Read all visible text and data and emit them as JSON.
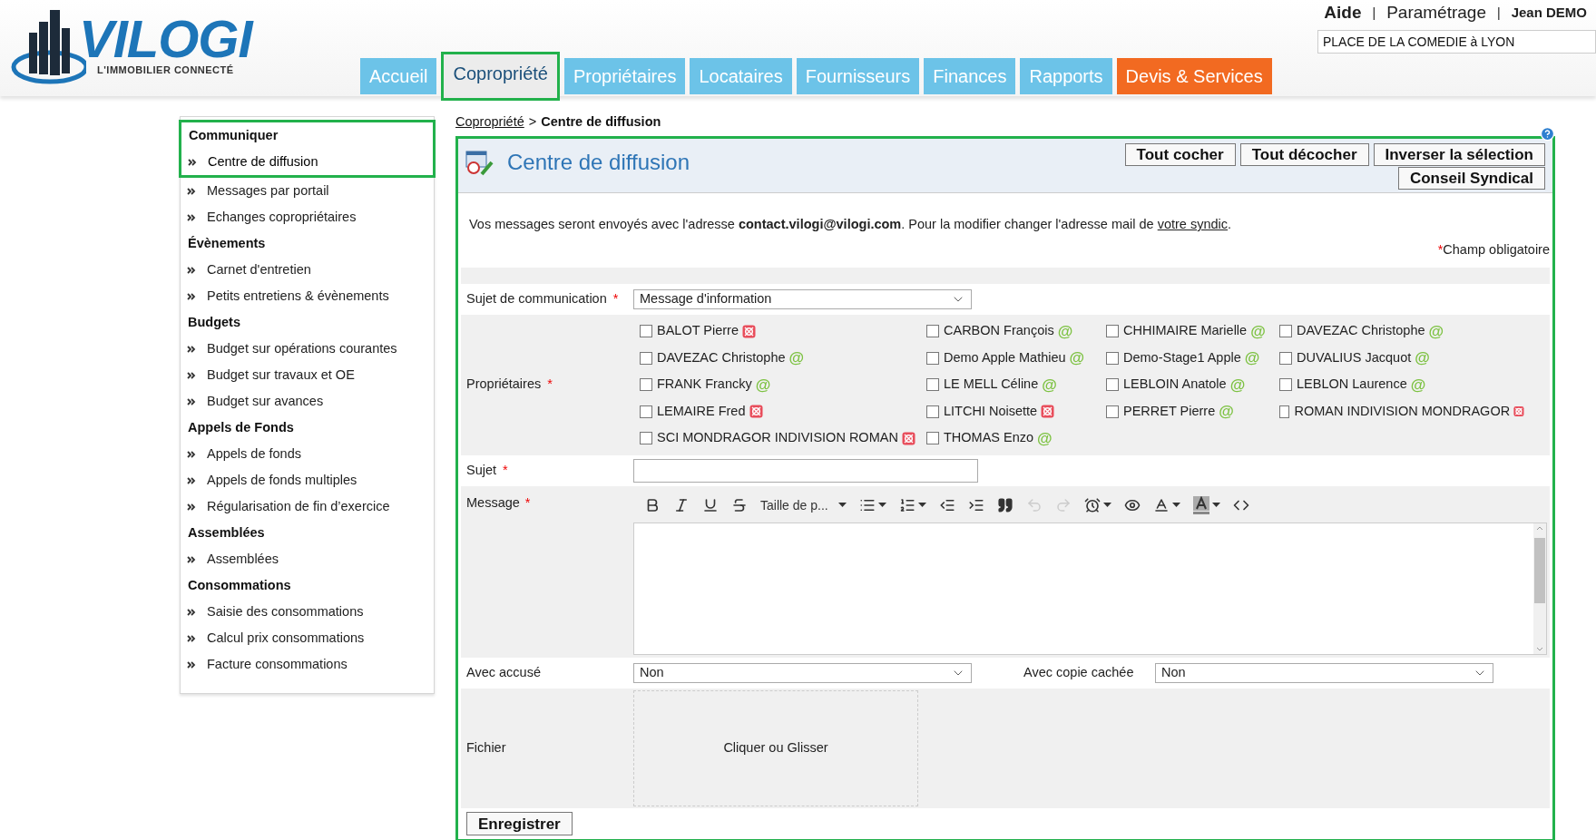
{
  "logo": {
    "name": "VILOGI",
    "tagline": "L'IMMOBILIER CONNECTÉ"
  },
  "top_separator": "|",
  "top_links": [
    {
      "label": "Aide",
      "kind": "link"
    },
    {
      "label": "Paramétrage",
      "kind": "link"
    },
    {
      "label": "Jean DEMO",
      "kind": "user"
    }
  ],
  "address_field": {
    "value": "PLACE DE LA COMEDIE à LYON"
  },
  "tabs": [
    {
      "label": "Accueil",
      "selected": false,
      "kind": "normal"
    },
    {
      "label": "Copropriété",
      "selected": true,
      "kind": "normal"
    },
    {
      "label": "Propriétaires",
      "selected": false,
      "kind": "normal"
    },
    {
      "label": "Locataires",
      "selected": false,
      "kind": "normal"
    },
    {
      "label": "Fournisseurs",
      "selected": false,
      "kind": "normal"
    },
    {
      "label": "Finances",
      "selected": false,
      "kind": "normal"
    },
    {
      "label": "Rapports",
      "selected": false,
      "kind": "normal"
    },
    {
      "label": "Devis & Services",
      "selected": false,
      "kind": "accent"
    }
  ],
  "sidebar": {
    "groups": [
      {
        "title": "Communiquer",
        "items": [
          {
            "label": "Centre de diffusion",
            "selected": true
          },
          {
            "label": "Messages par portail",
            "selected": false
          },
          {
            "label": "Echanges copropriétaires",
            "selected": false
          }
        ]
      },
      {
        "title": "Évènements",
        "items": [
          {
            "label": "Carnet d'entretien",
            "selected": false
          },
          {
            "label": "Petits entretiens & évènements",
            "selected": false
          }
        ]
      },
      {
        "title": "Budgets",
        "items": [
          {
            "label": "Budget sur opérations courantes",
            "selected": false
          },
          {
            "label": "Budget sur travaux et OE",
            "selected": false
          },
          {
            "label": "Budget sur avances",
            "selected": false
          }
        ]
      },
      {
        "title": "Appels de Fonds",
        "items": [
          {
            "label": "Appels de fonds",
            "selected": false
          },
          {
            "label": "Appels de fonds multiples",
            "selected": false
          },
          {
            "label": "Régularisation de fin d’exercice",
            "selected": false
          }
        ]
      },
      {
        "title": "Assemblées",
        "items": [
          {
            "label": "Assemblées",
            "selected": false
          }
        ]
      },
      {
        "title": "Consommations",
        "items": [
          {
            "label": "Saisie des consommations",
            "selected": false
          },
          {
            "label": "Calcul prix consommations",
            "selected": false
          },
          {
            "label": "Facture consommations",
            "selected": false
          }
        ]
      }
    ]
  },
  "breadcrumb": {
    "parent": "Copropriété",
    "separator": ">",
    "current": "Centre de diffusion"
  },
  "panel": {
    "title": "Centre de diffusion",
    "buttons": [
      "Tout cocher",
      "Tout décocher",
      "Inverser la sélection",
      "Conseil Syndical"
    ],
    "info": "Vos messages seront envoyés avec l'adresse **contact.vilogi@vilogi.com**. Pour la modifier changer l'adresse mail de",
    "info_link": "votre syndic",
    "info_end": ".",
    "required_mark": "*",
    "email_mark": "@",
    "required_note": "Champ obligatoire",
    "subject_type": {
      "label": "Sujet de communication",
      "required": true,
      "value": "Message d'information"
    },
    "owners": {
      "label": "Propriétaires",
      "required": true,
      "columns": [
        [
          {
            "name": "BALOT Pierre",
            "kind": "no-email",
            "checked": false
          },
          {
            "name": "DAVEZAC Christophe",
            "kind": "email",
            "checked": false
          },
          {
            "name": "FRANK Francky",
            "kind": "email",
            "checked": false
          },
          {
            "name": "LEMAIRE Fred",
            "kind": "no-email",
            "checked": false
          },
          {
            "name": "SCI MONDRAGOR INDIVISION ROMAN",
            "kind": "no-email",
            "checked": false
          }
        ],
        [
          {
            "name": "CARBON François",
            "kind": "email",
            "checked": false
          },
          {
            "name": "Demo Apple Mathieu",
            "kind": "email",
            "checked": false
          },
          {
            "name": "LE MELL Céline",
            "kind": "email",
            "checked": false
          },
          {
            "name": "LITCHI Noisette",
            "kind": "no-email",
            "checked": false
          },
          {
            "name": "THOMAS Enzo",
            "kind": "email",
            "checked": false
          }
        ],
        [
          {
            "name": "CHHIMAIRE Marielle",
            "kind": "email",
            "checked": false
          },
          {
            "name": "Demo-Stage1 Apple",
            "kind": "email",
            "checked": false
          },
          {
            "name": "LEBLOIN Anatole",
            "kind": "email",
            "checked": false
          },
          {
            "name": "PERRET Pierre",
            "kind": "email",
            "checked": false
          }
        ],
        [
          {
            "name": "DAVEZAC Christophe",
            "kind": "email",
            "checked": false
          },
          {
            "name": "DUVALIUS Jacquot",
            "kind": "email",
            "checked": false
          },
          {
            "name": "LEBLON Laurence",
            "kind": "email",
            "checked": false
          },
          {
            "name": "ROMAN INDIVISION MONDRAGOR",
            "kind": "no-email",
            "checked": false
          }
        ]
      ]
    },
    "subject": {
      "label": "Sujet",
      "required": true
    },
    "message": {
      "label": "Message",
      "required": true,
      "font_size": "Taille de p...",
      "undo_disabled": true,
      "redo_disabled": true
    },
    "receipt": {
      "label": "Avec accusé",
      "value": "Non"
    },
    "bcc": {
      "label": "Avec copie cachée",
      "value": "Non"
    },
    "file": {
      "label": "Fichier",
      "dropzone": "Cliquer ou Glisser"
    },
    "save": "Enregistrer"
  }
}
